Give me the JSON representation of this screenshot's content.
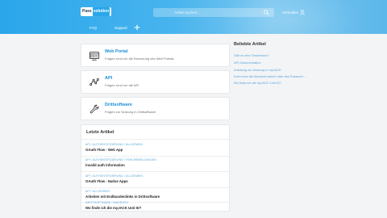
{
  "header": {
    "logo_main": "Pass",
    "logo_accent": "solution",
    "search_placeholder": "Artikel suchen ...",
    "login_label": "Anmelden",
    "nav": {
      "faq": "FAQ",
      "support": "Support"
    }
  },
  "categories": [
    {
      "title": "Web Portal",
      "description": "Fragen rund um die Benutzung des Web Portals",
      "icon": "web-portal-icon"
    },
    {
      "title": "API",
      "description": "Fragen rund um die API",
      "icon": "api-icon"
    },
    {
      "title": "Drittsoftware",
      "description": "Fragen zur Nutzung in Drittsoftware",
      "icon": "wrench-icon"
    }
  ],
  "latest": {
    "heading": "Letzte Artikel",
    "articles": [
      {
        "crumb": "API  /  AUTHENTIFIZIERUNG  /  ALLGEMEIN",
        "title": "OAuth Flow - Web App"
      },
      {
        "crumb": "API  /  AUTHENTIFIZIERUNG  /  FEHLERMELDUNGEN",
        "title": "invalid auth information"
      },
      {
        "crumb": "API  /  AUTHENTIFIZIERUNG  /  ALLGEMEIN",
        "title": "OAuth Flow - Native Apps"
      },
      {
        "crumb": "API  /  ALLGEMEIN",
        "title": "Arbeiten mit Endkundenlinks in Drittsoftware"
      },
      {
        "crumb": "DRITTSOFTWARE  /  MAGENTO",
        "title": "Wo finde ich die myJACK Uml ID?"
      }
    ]
  },
  "popular": {
    "heading": "Beliebte Artikel",
    "links": [
      "Gibt es eine Testversion?",
      "API Dokumentation",
      "Anleitung zur Nutzung in myJACK",
      "Kann man die Benutzernamen oder das Passwort ...",
      "Wo finde ich die myJACK Uml ID?"
    ]
  },
  "colors": {
    "accent": "#1a8fd8",
    "header": "#2aa6ea",
    "link": "#5aa7d8"
  }
}
